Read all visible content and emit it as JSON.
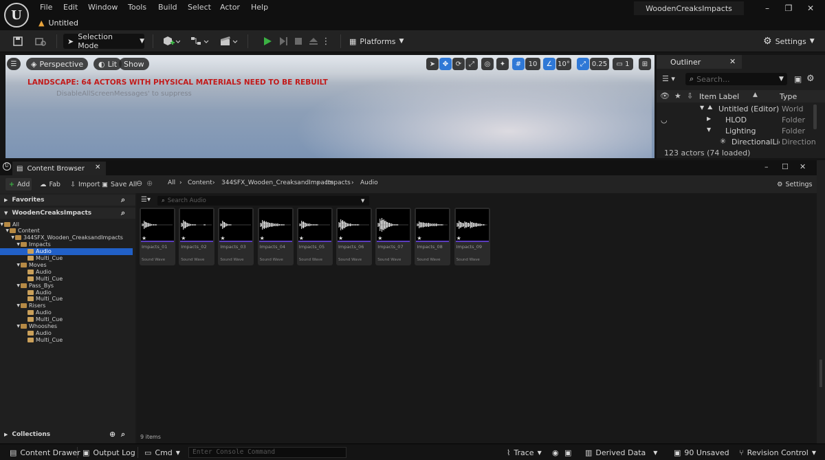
{
  "app": {
    "logo_glyph": "U",
    "document_tab": "Untitled",
    "project_name": "WoodenCreaksImpacts",
    "menu": [
      "File",
      "Edit",
      "Window",
      "Tools",
      "Build",
      "Select",
      "Actor",
      "Help"
    ]
  },
  "toolbar": {
    "selection_mode": "Selection Mode",
    "platforms": "Platforms",
    "settings": "Settings"
  },
  "viewport": {
    "perspective": "Perspective",
    "lit": "Lit",
    "show": "Show",
    "grid_snap": "10",
    "rotation_snap": "10°",
    "scale_snap": "0.25",
    "camera_speed": "1",
    "warning": "LANDSCAPE: 64 ACTORS WITH PHYSICAL MATERIALS NEED TO BE REBUILT",
    "suppress_hint": "DisableAllScreenMessages' to suppress"
  },
  "outliner": {
    "tab": "Outliner",
    "search_placeholder": "Search...",
    "columns": {
      "label": "Item Label",
      "type": "Type"
    },
    "rows": [
      {
        "label": "Untitled (Editor)",
        "type": "World"
      },
      {
        "label": "HLOD",
        "type": "Folder"
      },
      {
        "label": "Lighting",
        "type": "Folder"
      },
      {
        "label": "DirectionalLigh",
        "type": "Direction"
      }
    ],
    "footer": "123 actors (74 loaded)"
  },
  "content_browser": {
    "tab": "Content Browser",
    "buttons": {
      "add": "Add",
      "fab": "Fab",
      "import": "Import",
      "save_all": "Save All",
      "settings": "Settings"
    },
    "breadcrumb": [
      "All",
      "Content",
      "344SFX_Wooden_CreaksandImpacts",
      "Impacts",
      "Audio"
    ],
    "favorites": "Favorites",
    "project_header": "WoodenCreaksImpacts",
    "collections": "Collections",
    "tree": [
      {
        "label": "All",
        "depth": 0
      },
      {
        "label": "Content",
        "depth": 1
      },
      {
        "label": "344SFX_Wooden_CreaksandImpacts",
        "depth": 2
      },
      {
        "label": "Impacts",
        "depth": 3
      },
      {
        "label": "Audio",
        "depth": 4,
        "selected": true
      },
      {
        "label": "Multi_Cue",
        "depth": 4
      },
      {
        "label": "Moves",
        "depth": 3
      },
      {
        "label": "Audio",
        "depth": 4
      },
      {
        "label": "Multi_Cue",
        "depth": 4
      },
      {
        "label": "Pass_Bys",
        "depth": 3
      },
      {
        "label": "Audio",
        "depth": 4
      },
      {
        "label": "Multi_Cue",
        "depth": 4
      },
      {
        "label": "Risers",
        "depth": 3
      },
      {
        "label": "Audio",
        "depth": 4
      },
      {
        "label": "Multi_Cue",
        "depth": 4
      },
      {
        "label": "Whooshes",
        "depth": 3
      },
      {
        "label": "Audio",
        "depth": 4
      },
      {
        "label": "Multi_Cue",
        "depth": 4
      }
    ],
    "search_placeholder": "Search Audio",
    "asset_type": "Sound Wave",
    "assets": [
      "Impacts_01",
      "Impacts_02",
      "Impacts_03",
      "Impacts_04",
      "Impacts_05",
      "Impacts_06",
      "Impacts_07",
      "Impacts_08",
      "Impacts_09"
    ],
    "item_count": "9 items"
  },
  "statusbar": {
    "content_drawer": "Content Drawer",
    "output_log": "Output Log",
    "cmd": "Cmd",
    "console_placeholder": "Enter Console Command",
    "trace": "Trace",
    "derived_data": "Derived Data",
    "unsaved": "90 Unsaved",
    "revision_control": "Revision Control"
  },
  "colors": {
    "accent_blue": "#2f78d6",
    "selection_blue": "#2160c7",
    "play_green": "#3bb143",
    "warning_red": "#c21a1a",
    "folder_tan": "#caa05a",
    "asset_bar_purple": "#5b3dbf"
  }
}
